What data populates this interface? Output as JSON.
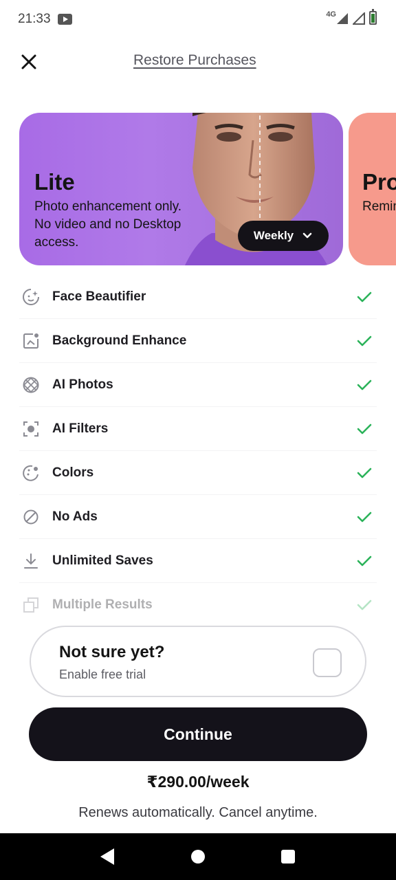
{
  "status_bar": {
    "time": "21:33",
    "network": "4G"
  },
  "header": {
    "restore_label": "Restore Purchases"
  },
  "plans": {
    "lite": {
      "name": "Lite",
      "description": "Photo enhancement only. No video and no Desktop access.",
      "period_label": "Weekly",
      "color": "#a86be6"
    },
    "pro": {
      "name": "Pro",
      "description": "Remini both on Deskto",
      "color": "#f69a8c"
    }
  },
  "features": [
    {
      "label": "Face Beautifier",
      "icon": "face-beautifier-icon",
      "included": true
    },
    {
      "label": "Background Enhance",
      "icon": "background-enhance-icon",
      "included": true
    },
    {
      "label": "AI Photos",
      "icon": "ai-photos-icon",
      "included": true
    },
    {
      "label": "AI Filters",
      "icon": "ai-filters-icon",
      "included": true
    },
    {
      "label": "Colors",
      "icon": "colors-icon",
      "included": true
    },
    {
      "label": "No Ads",
      "icon": "no-ads-icon",
      "included": true
    },
    {
      "label": "Unlimited Saves",
      "icon": "download-icon",
      "included": true
    },
    {
      "label": "Multiple Results",
      "icon": "multiple-results-icon",
      "included": true
    }
  ],
  "trial": {
    "title": "Not sure yet?",
    "subtitle": "Enable free trial",
    "checked": false
  },
  "cta": {
    "continue_label": "Continue",
    "price": "₹290.00/week",
    "renew_note": "Renews automatically. Cancel anytime."
  },
  "colors": {
    "check_green": "#2bb35a",
    "button_dark": "#14121a"
  }
}
